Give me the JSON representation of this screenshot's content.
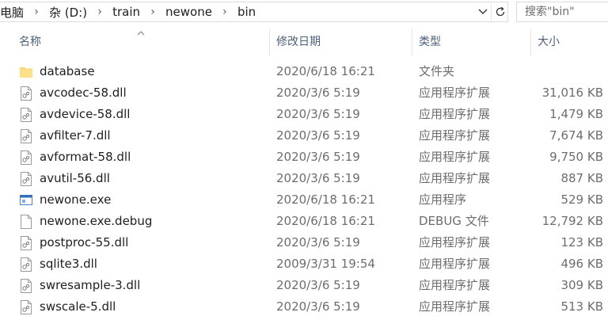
{
  "address": {
    "crumbs": [
      "电脑",
      "杂 (D:)",
      "train",
      "newone",
      "bin"
    ],
    "separator": "›"
  },
  "search": {
    "placeholder": "搜索\"bin\""
  },
  "columns": {
    "name": "名称",
    "date": "修改日期",
    "type": "类型",
    "size": "大小"
  },
  "files": [
    {
      "name": "database",
      "date": "2020/6/18 16:21",
      "type": "文件夹",
      "size": "",
      "icon": "folder-icon"
    },
    {
      "name": "avcodec-58.dll",
      "date": "2020/3/6 5:19",
      "type": "应用程序扩展",
      "size": "31,016 KB",
      "icon": "dll-icon"
    },
    {
      "name": "avdevice-58.dll",
      "date": "2020/3/6 5:19",
      "type": "应用程序扩展",
      "size": "1,479 KB",
      "icon": "dll-icon"
    },
    {
      "name": "avfilter-7.dll",
      "date": "2020/3/6 5:19",
      "type": "应用程序扩展",
      "size": "7,674 KB",
      "icon": "dll-icon"
    },
    {
      "name": "avformat-58.dll",
      "date": "2020/3/6 5:19",
      "type": "应用程序扩展",
      "size": "9,750 KB",
      "icon": "dll-icon"
    },
    {
      "name": "avutil-56.dll",
      "date": "2020/3/6 5:19",
      "type": "应用程序扩展",
      "size": "887 KB",
      "icon": "dll-icon"
    },
    {
      "name": "newone.exe",
      "date": "2020/6/18 16:21",
      "type": "应用程序",
      "size": "529 KB",
      "icon": "exe-icon"
    },
    {
      "name": "newone.exe.debug",
      "date": "2020/6/18 16:21",
      "type": "DEBUG 文件",
      "size": "12,792 KB",
      "icon": "file-icon"
    },
    {
      "name": "postproc-55.dll",
      "date": "2020/3/6 5:19",
      "type": "应用程序扩展",
      "size": "123 KB",
      "icon": "dll-icon"
    },
    {
      "name": "sqlite3.dll",
      "date": "2009/3/31 19:54",
      "type": "应用程序扩展",
      "size": "496 KB",
      "icon": "dll-icon"
    },
    {
      "name": "swresample-3.dll",
      "date": "2020/3/6 5:19",
      "type": "应用程序扩展",
      "size": "309 KB",
      "icon": "dll-icon"
    },
    {
      "name": "swscale-5.dll",
      "date": "2020/3/6 5:19",
      "type": "应用程序扩展",
      "size": "513 KB",
      "icon": "dll-icon"
    }
  ]
}
